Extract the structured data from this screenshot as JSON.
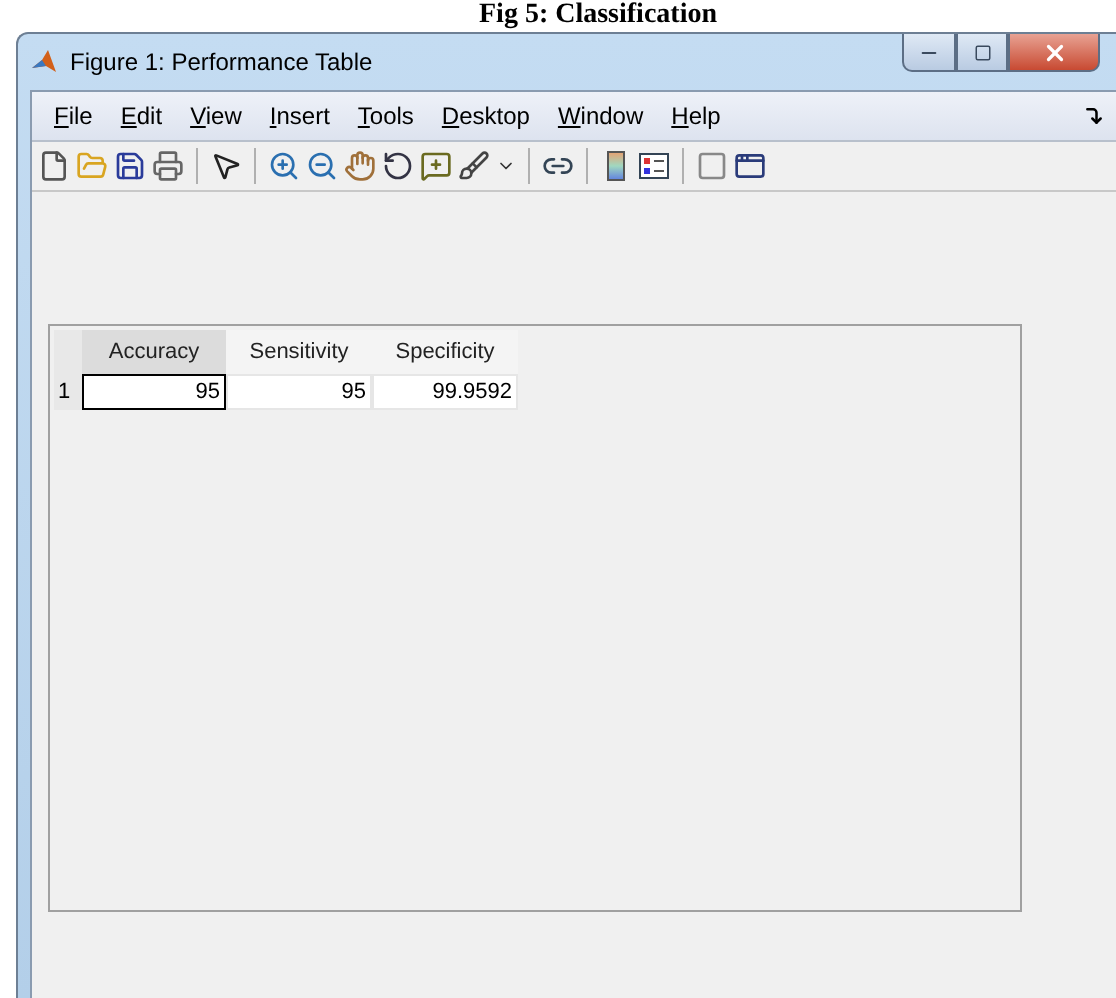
{
  "caption": "Fig 5: Classification",
  "window": {
    "title": "Figure 1: Performance Table"
  },
  "menu": [
    "File",
    "Edit",
    "View",
    "Insert",
    "Tools",
    "Desktop",
    "Window",
    "Help"
  ],
  "table": {
    "columns": [
      "Accuracy",
      "Sensitivity",
      "Specificity"
    ],
    "rows": [
      {
        "header": "1",
        "cells": [
          {
            "value": "95",
            "focused": true
          },
          {
            "value": "95",
            "focused": false
          },
          {
            "value": "99.9592",
            "focused": false
          }
        ]
      }
    ]
  }
}
